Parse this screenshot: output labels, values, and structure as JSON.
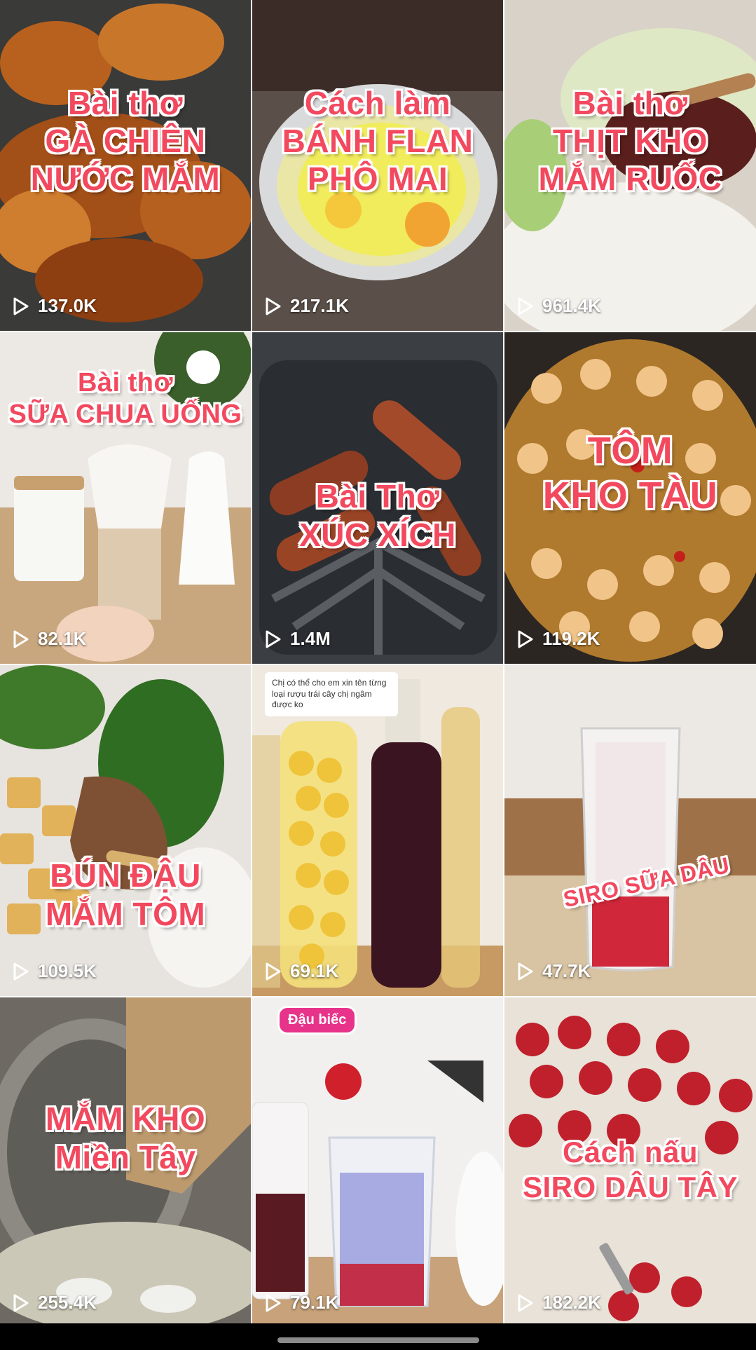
{
  "grid": {
    "videos": [
      {
        "title_lines": [
          "Bài thơ",
          "GÀ CHIÊN",
          "NƯỚC MẮM"
        ],
        "views": "137.0K"
      },
      {
        "title_lines": [
          "Cách làm",
          "BÁNH FLAN",
          "PHÔ MAI"
        ],
        "views": "217.1K"
      },
      {
        "title_lines": [
          "Bài thơ",
          "THỊT KHO",
          "MẮM RUỐC"
        ],
        "views": "961.4K"
      },
      {
        "title_lines": [
          "Bài thơ",
          "SỮA CHUA UỐNG"
        ],
        "views": "82.1K"
      },
      {
        "title_lines": [
          "Bài Thơ",
          "XÚC XÍCH"
        ],
        "views": "1.4M"
      },
      {
        "title_lines": [
          "TÔM",
          "KHO TÀU"
        ],
        "views": "119.2K"
      },
      {
        "title_lines": [
          "BÚN ĐẬU",
          "MẮM TÔM"
        ],
        "views": "109.5K"
      },
      {
        "title_lines": [],
        "views": "69.1K"
      },
      {
        "title_lines": [
          "SIRO SỮA DÂU"
        ],
        "views": "47.7K"
      },
      {
        "title_lines": [
          "MẮM KHO",
          "Miền Tây"
        ],
        "views": "255.4K"
      },
      {
        "title_lines": [],
        "views": "79.1K"
      },
      {
        "title_lines": [
          "Cách nấu",
          "SIRO DÂU TÂY"
        ],
        "views": "182.2K"
      }
    ]
  },
  "extras": {
    "tag_tile11": "Đậu biếc",
    "comment_tile8": "Chị có thể cho em xin tên từng loại rượu trái cây chị ngâm được ko"
  },
  "icons": {
    "play": "play-icon"
  },
  "colors": {
    "title_text": "#f2495f",
    "title_outline": "#ffffff",
    "views_text": "#ffffff"
  }
}
